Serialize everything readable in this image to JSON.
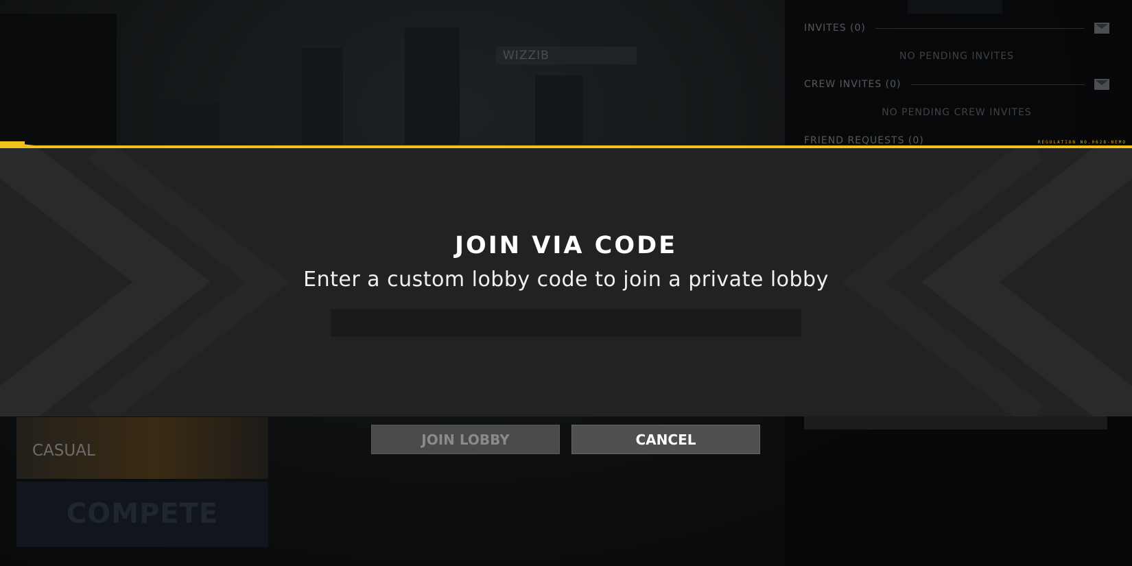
{
  "background": {
    "player_name": "WIZZIB",
    "social": {
      "invites_label": "INVITES (0)",
      "invites_empty": "NO PENDING INVITES",
      "crew_invites_label": "CREW INVITES (0)",
      "crew_invites_empty": "NO PENDING CREW INVITES",
      "friend_requests_label": "FRIEND REQUESTS (0)"
    },
    "left_tile_label": "CASUAL",
    "compete_label": "COMPETE"
  },
  "modal": {
    "regulation_text": "REGULATION NO.0628-NEMO",
    "title": "JOIN VIA CODE",
    "subtitle": "Enter a custom lobby code to join a private lobby",
    "code_input": {
      "value": "",
      "placeholder": ""
    },
    "join_button_label": "JOIN LOBBY",
    "cancel_button_label": "CANCEL"
  },
  "colors": {
    "accent_yellow": "#f2c21a",
    "modal_bg": "#222222",
    "button_bg": "#505050"
  },
  "icons": [
    "mail-icon"
  ]
}
